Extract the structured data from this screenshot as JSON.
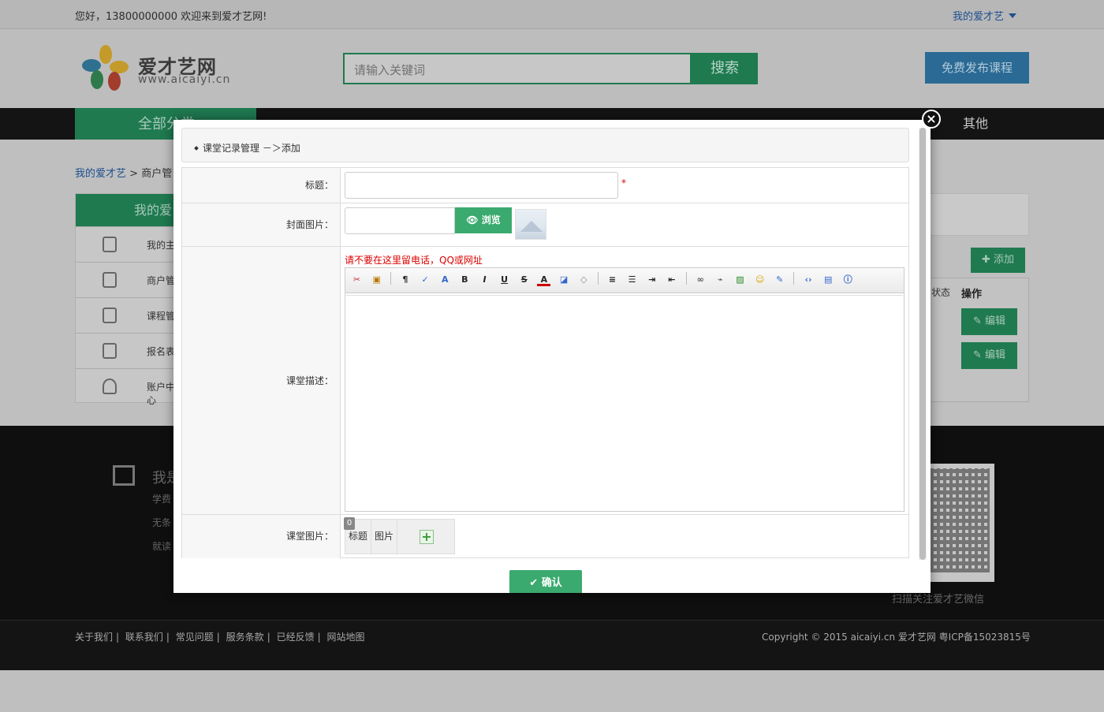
{
  "topbar": {
    "welcome": "您好，13800000000 欢迎来到爱才艺网!",
    "my_menu": "我的爱才艺"
  },
  "header": {
    "logo_name": "爱才艺网",
    "logo_url": "www.aicaiyi.cn",
    "search_placeholder": "请输入关键词",
    "search_button": "搜索",
    "publish_button": "免费发布课程"
  },
  "nav": {
    "all_categories": "全部分类",
    "other": "其他"
  },
  "breadcrumb": {
    "home": "我的爱才艺",
    "sep": ">",
    "current": "商户管"
  },
  "sidebar": {
    "title": "我的爱",
    "items": [
      {
        "label": "我的主",
        "icon": "home-icon"
      },
      {
        "label": "商户管",
        "icon": "briefcase-icon"
      },
      {
        "label": "课程管",
        "icon": "document-icon"
      },
      {
        "label": "报名表",
        "icon": "clipboard-icon"
      },
      {
        "label": "账户中心",
        "icon": "user-icon"
      }
    ]
  },
  "main": {
    "add_button": "添加",
    "col_status": "状态",
    "col_action": "操作",
    "edit_label": "编辑"
  },
  "footer": {
    "title": "我是",
    "lines": [
      "学费",
      "无条",
      "就读"
    ],
    "qr_caption": "扫描关注爱才艺微信",
    "links": [
      "关于我们",
      "联系我们",
      "常见问题",
      "服务条款",
      "已经反馈",
      "网站地图"
    ],
    "copyright": "Copyright © 2015 aicaiyi.cn 爱才艺网 粤ICP备15023815号"
  },
  "modal": {
    "breadcrumb": "课堂记录管理 －＞添加",
    "fields": {
      "title_label": "标题：",
      "required_mark": "*",
      "cover_label": "封面图片：",
      "browse_button": "浏览",
      "desc_label": "课堂描述：",
      "desc_warning": "请不要在这里留电话，QQ或网址",
      "images_label": "课堂图片：",
      "images_count": "0",
      "images_col_title": "标题",
      "images_col_image": "图片"
    },
    "confirm_button": "确认",
    "toolbar_icons": [
      "cut-icon",
      "paste-icon",
      "format-icon",
      "spellcheck-icon",
      "font-icon",
      "bold-icon",
      "italic-icon",
      "underline-icon",
      "strikethrough-icon",
      "font-color-icon",
      "highlight-icon",
      "eraser-icon",
      "align-icon",
      "list-icon",
      "indent-icon",
      "outdent-icon",
      "link-icon",
      "unlink-icon",
      "image-icon",
      "emoticon-icon",
      "edit-icon",
      "source-code-icon",
      "preview-icon",
      "about-icon"
    ]
  }
}
